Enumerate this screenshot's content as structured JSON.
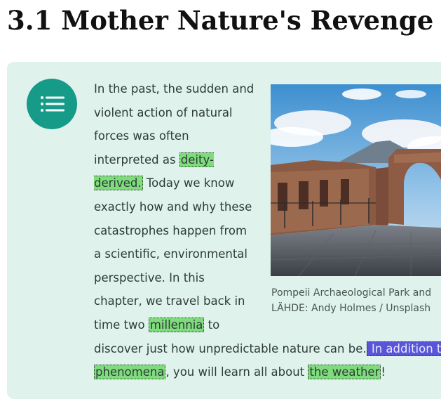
{
  "page": {
    "title": "3.1 Mother Nature's Revenge"
  },
  "menu": {
    "icon": "list-icon"
  },
  "content": {
    "seg1": "In the past, the sudden and violent action of natural forces was often interpreted as ",
    "hl1": "deity-derived.",
    "seg2": " Today we know exactly how and why these catastrophes happen from a scientific, environmental perspective. In this chapter, we travel back in time two ",
    "hl2": "millennia",
    "seg3": " to discover just how unpredictable nature can be.",
    "hl3": " In addition t",
    "hl4": "phenomena",
    "seg4": ", you will learn all about ",
    "hl5": "the weather",
    "seg5": "!"
  },
  "figure": {
    "caption_line1": "Pompeii Archaeological Park and",
    "caption_line2": "LÄHDE: Andy Holmes / Unsplash"
  },
  "colors": {
    "accent": "#159b88",
    "panel_bg": "#dff2ec",
    "highlight_green": "#7fdc7c",
    "highlight_blue": "#5a55d8"
  }
}
